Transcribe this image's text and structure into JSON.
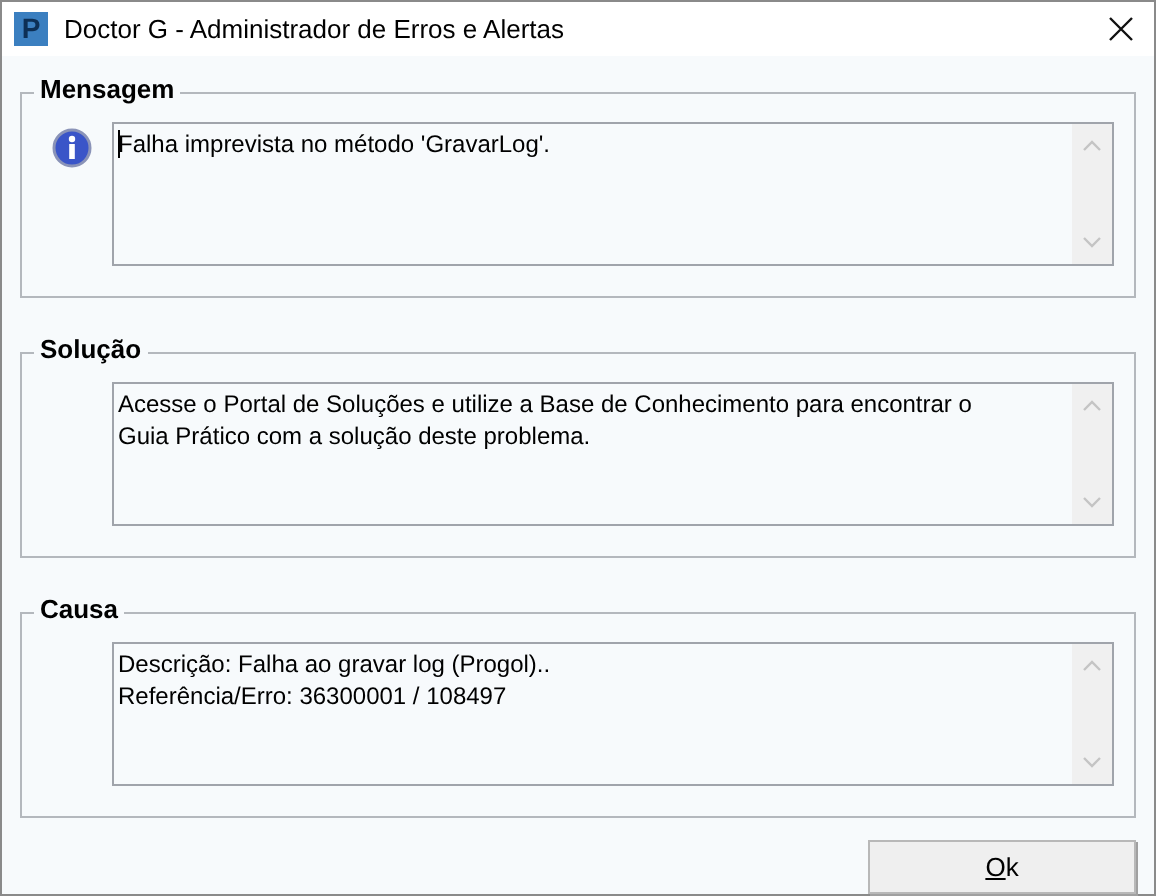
{
  "window": {
    "logo": "P",
    "title": "Doctor G - Administrador de Erros e Alertas"
  },
  "sections": [
    {
      "title": "Mensagem",
      "kind": "with_icon",
      "text": "Falha imprevista no método 'GravarLog'.",
      "caret": true
    },
    {
      "title": "Solução",
      "kind": "plain",
      "text": "Acesse o Portal de Soluções e utilize a Base de Conhecimento para encontrar o Guia Prático com a solução deste problema.",
      "caret": false
    },
    {
      "title": "Causa",
      "kind": "plain",
      "text": "Descrição: Falha ao gravar log (Progol)..\nReferência/Erro: 36300001 / 108497",
      "caret": false
    }
  ],
  "buttons": [
    {
      "label": "Ok"
    }
  ]
}
